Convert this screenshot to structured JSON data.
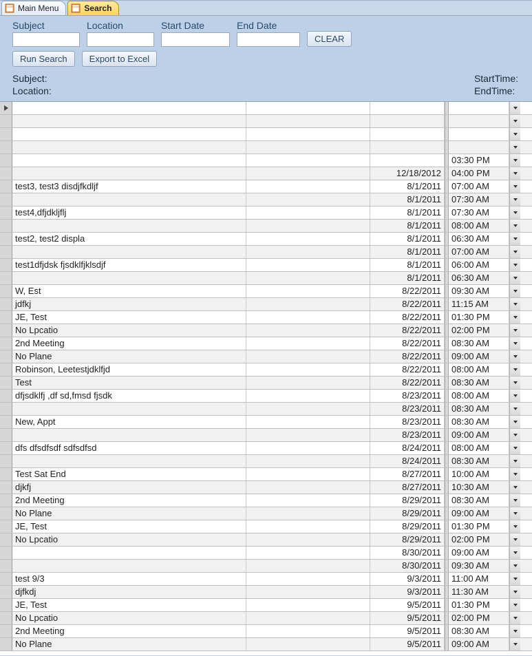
{
  "tabs": [
    {
      "label": "Main Menu",
      "active": false
    },
    {
      "label": "Search",
      "active": true
    }
  ],
  "filters": {
    "subject": {
      "label": "Subject",
      "value": ""
    },
    "location": {
      "label": "Location",
      "value": ""
    },
    "startdate": {
      "label": "Start Date",
      "value": ""
    },
    "enddate": {
      "label": "End Date",
      "value": ""
    },
    "clear_label": "CLEAR"
  },
  "actions": {
    "run_search": "Run Search",
    "export": "Export to Excel"
  },
  "summary": {
    "left": [
      {
        "label": "Subject:",
        "value": ""
      },
      {
        "label": "Location:",
        "value": ""
      }
    ],
    "right": [
      {
        "label": "StartTime:",
        "value": ""
      },
      {
        "label": "EndTime:",
        "value": ""
      }
    ]
  },
  "rows": [
    {
      "subject": "",
      "date": "",
      "time": ""
    },
    {
      "subject": "",
      "date": "",
      "time": ""
    },
    {
      "subject": "",
      "date": "",
      "time": ""
    },
    {
      "subject": "",
      "date": "",
      "time": ""
    },
    {
      "subject": "",
      "date": "",
      "time": "03:30 PM"
    },
    {
      "subject": "",
      "date": "12/18/2012",
      "time": "04:00 PM"
    },
    {
      "subject": "test3, test3 disdjfkdljf",
      "date": "8/1/2011",
      "time": "07:00 AM"
    },
    {
      "subject": "",
      "date": "8/1/2011",
      "time": "07:30 AM"
    },
    {
      "subject": "test4,dfjdkljflj",
      "date": "8/1/2011",
      "time": "07:30 AM"
    },
    {
      "subject": "",
      "date": "8/1/2011",
      "time": "08:00 AM"
    },
    {
      "subject": "test2, test2 displa",
      "date": "8/1/2011",
      "time": "06:30 AM"
    },
    {
      "subject": "",
      "date": "8/1/2011",
      "time": "07:00 AM"
    },
    {
      "subject": "test1dfjdsk fjsdklfjklsdjf",
      "date": "8/1/2011",
      "time": "06:00 AM"
    },
    {
      "subject": "",
      "date": "8/1/2011",
      "time": "06:30 AM"
    },
    {
      "subject": "W, Est",
      "date": "8/22/2011",
      "time": "09:30 AM"
    },
    {
      "subject": "jdfkj",
      "date": "8/22/2011",
      "time": "11:15 AM"
    },
    {
      "subject": "JE, Test",
      "date": "8/22/2011",
      "time": "01:30 PM"
    },
    {
      "subject": "No Lpcatio",
      "date": "8/22/2011",
      "time": "02:00 PM"
    },
    {
      "subject": "2nd Meeting",
      "date": "8/22/2011",
      "time": "08:30 AM"
    },
    {
      "subject": "No Plane",
      "date": "8/22/2011",
      "time": "09:00 AM"
    },
    {
      "subject": "Robinson, Leetestjdklfjd",
      "date": "8/22/2011",
      "time": "08:00 AM"
    },
    {
      "subject": "Test",
      "date": "8/22/2011",
      "time": "08:30 AM"
    },
    {
      "subject": "dfjsdklfj ,df sd,fmsd fjsdk",
      "date": "8/23/2011",
      "time": "08:00 AM"
    },
    {
      "subject": "",
      "date": "8/23/2011",
      "time": "08:30 AM"
    },
    {
      "subject": "New, Appt",
      "date": "8/23/2011",
      "time": "08:30 AM"
    },
    {
      "subject": "",
      "date": "8/23/2011",
      "time": "09:00 AM"
    },
    {
      "subject": "dfs dfsdfsdf sdfsdfsd",
      "date": "8/24/2011",
      "time": "08:00 AM"
    },
    {
      "subject": "",
      "date": "8/24/2011",
      "time": "08:30 AM"
    },
    {
      "subject": "Test Sat End",
      "date": "8/27/2011",
      "time": "10:00 AM"
    },
    {
      "subject": "djkfj",
      "date": "8/27/2011",
      "time": "10:30 AM"
    },
    {
      "subject": "2nd Meeting",
      "date": "8/29/2011",
      "time": "08:30 AM"
    },
    {
      "subject": "No Plane",
      "date": "8/29/2011",
      "time": "09:00 AM"
    },
    {
      "subject": "JE, Test",
      "date": "8/29/2011",
      "time": "01:30 PM"
    },
    {
      "subject": "No Lpcatio",
      "date": "8/29/2011",
      "time": "02:00 PM"
    },
    {
      "subject": "",
      "date": "8/30/2011",
      "time": "09:00 AM"
    },
    {
      "subject": "",
      "date": "8/30/2011",
      "time": "09:30 AM"
    },
    {
      "subject": "test 9/3",
      "date": "9/3/2011",
      "time": "11:00 AM"
    },
    {
      "subject": "djfkdj",
      "date": "9/3/2011",
      "time": "11:30 AM"
    },
    {
      "subject": "JE, Test",
      "date": "9/5/2011",
      "time": "01:30 PM"
    },
    {
      "subject": "No Lpcatio",
      "date": "9/5/2011",
      "time": "02:00 PM"
    },
    {
      "subject": "2nd Meeting",
      "date": "9/5/2011",
      "time": "08:30 AM"
    },
    {
      "subject": "No Plane",
      "date": "9/5/2011",
      "time": "09:00 AM"
    }
  ]
}
